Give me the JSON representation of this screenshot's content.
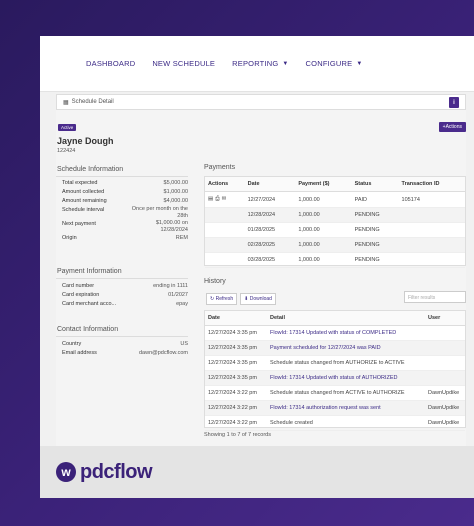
{
  "nav": {
    "dashboard": "DASHBOARD",
    "new_schedule": "NEW SCHEDULE",
    "reporting": "REPORTING",
    "configure": "CONFIGURE"
  },
  "header": {
    "title": "Schedule Detail",
    "info": "i"
  },
  "status_badge": "Active",
  "actions_label": "+Actions",
  "customer": {
    "name": "Jayne Dough",
    "account": "122424"
  },
  "schedule_info": {
    "title": "Schedule Information",
    "rows": [
      {
        "k": "Total expected",
        "v": "$5,000.00"
      },
      {
        "k": "Amount collected",
        "v": "$1,000.00"
      },
      {
        "k": "Amount remaining",
        "v": "$4,000.00"
      },
      {
        "k": "Schedule interval",
        "v": "Once per month on the 28th"
      },
      {
        "k": "Next payment",
        "v": "$1,000.00 on 12/28/2024"
      },
      {
        "k": "Origin",
        "v": "REM"
      }
    ]
  },
  "payment_info": {
    "title": "Payment Information",
    "rows": [
      {
        "k": "Card number",
        "v": "ending in 1111"
      },
      {
        "k": "Card expiration",
        "v": "01/2027"
      },
      {
        "k": "Card merchant acco...",
        "v": "epay"
      }
    ]
  },
  "contact_info": {
    "title": "Contact Information",
    "rows": [
      {
        "k": "Country",
        "v": "US"
      },
      {
        "k": "Email address",
        "v": "dawn@pdcflow.com"
      }
    ]
  },
  "payments": {
    "title": "Payments",
    "headers": [
      "Actions",
      "Date",
      "Payment ($)",
      "Status",
      "Transaction ID"
    ],
    "rows": [
      {
        "date": "12/27/2024",
        "amount": "1,000.00",
        "status": "PAID",
        "txn": "105174"
      },
      {
        "date": "12/28/2024",
        "amount": "1,000.00",
        "status": "PENDING",
        "txn": ""
      },
      {
        "date": "01/28/2025",
        "amount": "1,000.00",
        "status": "PENDING",
        "txn": ""
      },
      {
        "date": "02/28/2025",
        "amount": "1,000.00",
        "status": "PENDING",
        "txn": ""
      },
      {
        "date": "03/28/2025",
        "amount": "1,000.00",
        "status": "PENDING",
        "txn": ""
      }
    ]
  },
  "history": {
    "title": "History",
    "refresh": "Refresh",
    "download": "Download",
    "filter_placeholder": "Filter results",
    "headers": [
      "Date",
      "Detail",
      "User"
    ],
    "rows": [
      {
        "date": "12/27/2024 3:35 pm",
        "detail": "FlowId: 17314 Updated with status of COMPLETED",
        "user": "",
        "link": true
      },
      {
        "date": "12/27/2024 3:35 pm",
        "detail": "Payment scheduled for 12/27/2024 was PAID",
        "user": "",
        "link": true
      },
      {
        "date": "12/27/2024 3:35 pm",
        "detail": "Schedule status changed from AUTHORIZE to ACTIVE",
        "user": "",
        "link": false
      },
      {
        "date": "12/27/2024 3:35 pm",
        "detail": "FlowId: 17314 Updated with status of AUTHORIZED",
        "user": "",
        "link": true
      },
      {
        "date": "12/27/2024 3:22 pm",
        "detail": "Schedule status changed from ACTIVE to AUTHORIZE",
        "user": "DawnUpdike",
        "link": false
      },
      {
        "date": "12/27/2024 3:22 pm",
        "detail": "FlowId: 17314 authorization request was sent",
        "user": "DawnUpdike",
        "link": true
      },
      {
        "date": "12/27/2024 3:22 pm",
        "detail": "Schedule created",
        "user": "DawnUpdike",
        "link": false
      }
    ],
    "footer": "Showing 1 to 7 of 7 records"
  },
  "brand": {
    "mark": "w",
    "name": "pdcflow"
  },
  "colors": {
    "accent": "#4a2b8c",
    "link": "#3b2a86"
  }
}
